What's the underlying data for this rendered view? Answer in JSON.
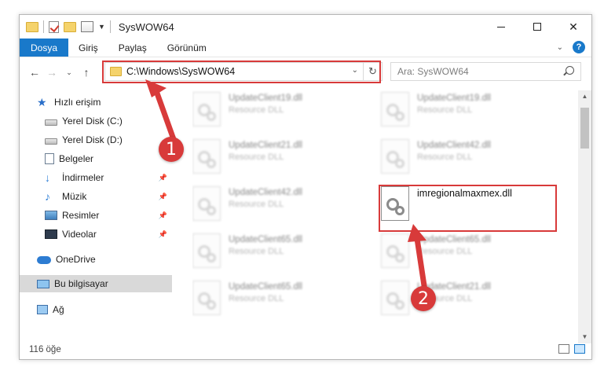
{
  "window": {
    "title": "SysWOW64"
  },
  "ribbon": {
    "tabs": [
      "Dosya",
      "Giriş",
      "Paylaş",
      "Görünüm"
    ]
  },
  "address": {
    "path": "C:\\Windows\\SysWOW64"
  },
  "search": {
    "placeholder": "Ara: SysWOW64"
  },
  "sidebar": {
    "items": [
      {
        "label": "Hızlı erişim",
        "icon": "star-icon"
      },
      {
        "label": "Yerel Disk (C:)",
        "icon": "drive-icon"
      },
      {
        "label": "Yerel Disk (D:)",
        "icon": "drive-icon"
      },
      {
        "label": "Belgeler",
        "icon": "documents-icon"
      },
      {
        "label": "İndirmeler",
        "icon": "downloads-icon"
      },
      {
        "label": "Müzik",
        "icon": "music-icon"
      },
      {
        "label": "Resimler",
        "icon": "pictures-icon"
      },
      {
        "label": "Videolar",
        "icon": "videos-icon"
      },
      {
        "label": "OneDrive",
        "icon": "cloud-icon"
      },
      {
        "label": "Bu bilgisayar",
        "icon": "computer-icon"
      },
      {
        "label": "Ağ",
        "icon": "network-icon"
      }
    ]
  },
  "files": [
    {
      "name": "UpdateClient19.dll",
      "type": "Resource DLL"
    },
    {
      "name": "UpdateClient19.dll",
      "type": "Resource DLL"
    },
    {
      "name": "UpdateClient21.dll",
      "type": "Resource DLL"
    },
    {
      "name": "UpdateClient42.dll",
      "type": "Resource DLL"
    },
    {
      "name": "UpdateClient42.dll",
      "type": "Resource DLL"
    },
    {
      "name": "imregionalmaxmex.dll",
      "type": ""
    },
    {
      "name": "UpdateClient65.dll",
      "type": "Resource DLL"
    },
    {
      "name": "UpdateClient65.dll",
      "type": "Resource DLL"
    },
    {
      "name": "UpdateClient65.dll",
      "type": "Resource DLL"
    },
    {
      "name": "UpdateClient21.dll",
      "type": "Resource DLL"
    }
  ],
  "status": {
    "count": "116 öğe"
  },
  "annotations": {
    "step1": "1",
    "step2": "2"
  },
  "colors": {
    "accent": "#1979ca",
    "annotation": "#d83a3a",
    "selected": "#d9d9d9"
  }
}
